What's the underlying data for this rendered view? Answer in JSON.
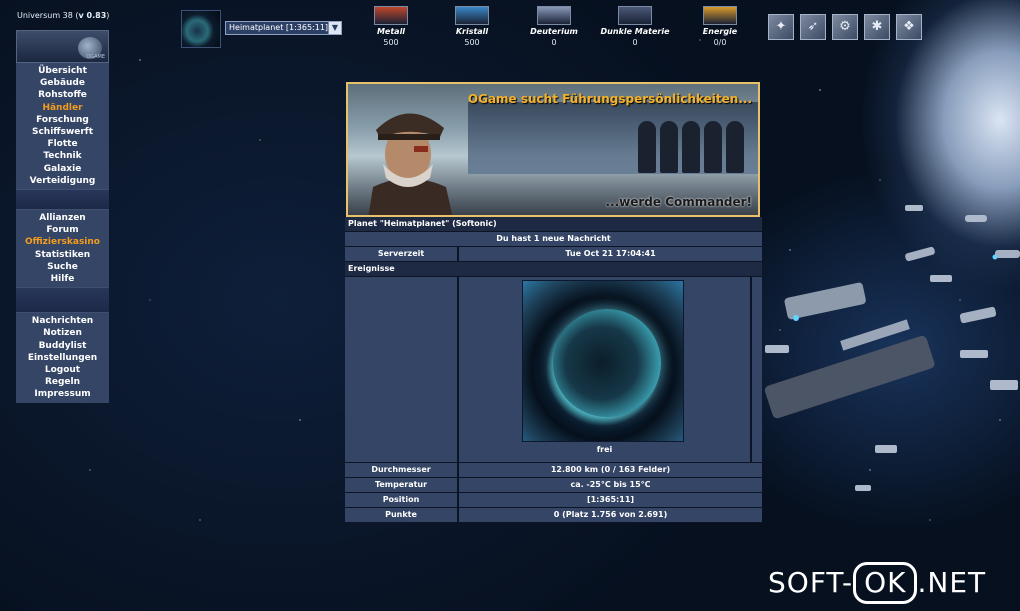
{
  "header": {
    "universe_label": "Universum 38",
    "version": "v 0.83"
  },
  "planet_select": {
    "selected": "Heimatplanet [1:365:11]"
  },
  "resources": [
    {
      "name": "Metall",
      "value": "500",
      "icon": "metal-icon",
      "color": "#c0452a"
    },
    {
      "name": "Kristall",
      "value": "500",
      "icon": "crystal-icon",
      "color": "#3a88c8"
    },
    {
      "name": "Deuterium",
      "value": "0",
      "icon": "deuterium-icon",
      "color": "#8898b8"
    },
    {
      "name": "Dunkle Materie",
      "value": "0",
      "icon": "dark-matter-icon",
      "color": "#4a5878"
    },
    {
      "name": "Energie",
      "value": "0/0",
      "icon": "energy-icon",
      "color": "#d99a2c"
    }
  ],
  "officers": [
    {
      "icon": "commander-icon",
      "glyph": "✦"
    },
    {
      "icon": "admiral-icon",
      "glyph": "➶"
    },
    {
      "icon": "engineer-icon",
      "glyph": "⚙"
    },
    {
      "icon": "geologist-icon",
      "glyph": "✱"
    },
    {
      "icon": "technocrat-icon",
      "glyph": "❖"
    }
  ],
  "menu": {
    "group1": [
      "Übersicht",
      "Gebäude",
      "Rohstoffe",
      "Händler",
      "Forschung",
      "Schiffswerft",
      "Flotte",
      "Technik",
      "Galaxie",
      "Verteidigung"
    ],
    "group2": [
      "Allianzen",
      "Forum",
      "Offizierskasino",
      "Statistiken",
      "Suche",
      "Hilfe"
    ],
    "group3": [
      "Nachrichten",
      "Notizen",
      "Buddylist",
      "Einstellungen",
      "Logout",
      "Regeln",
      "Impressum"
    ],
    "highlight_color": "#f59c1d"
  },
  "banner": {
    "headline": "OGame sucht Führungspersönlichkeiten...",
    "tagline": "...werde Commander!"
  },
  "overview": {
    "planet_title": "Planet \"Heimatplanet\" (Softonic)",
    "message": "Du hast 1 neue Nachricht",
    "server_time_label": "Serverzeit",
    "server_time_value": "Tue Oct 21 17:04:41",
    "events_label": "Ereignisse",
    "planet_caption": "frei",
    "rows": [
      {
        "label": "Durchmesser",
        "value": "12.800 km (0 / 163 Felder)"
      },
      {
        "label": "Temperatur",
        "value": "ca. -25°C bis 15°C"
      },
      {
        "label": "Position",
        "value": "[1:365:11]"
      },
      {
        "label": "Punkte",
        "value": "0 (Platz 1.756 von 2.691)"
      }
    ]
  },
  "watermark": {
    "left": "SOFT-",
    "middle": "OK",
    "right": ".NET"
  }
}
